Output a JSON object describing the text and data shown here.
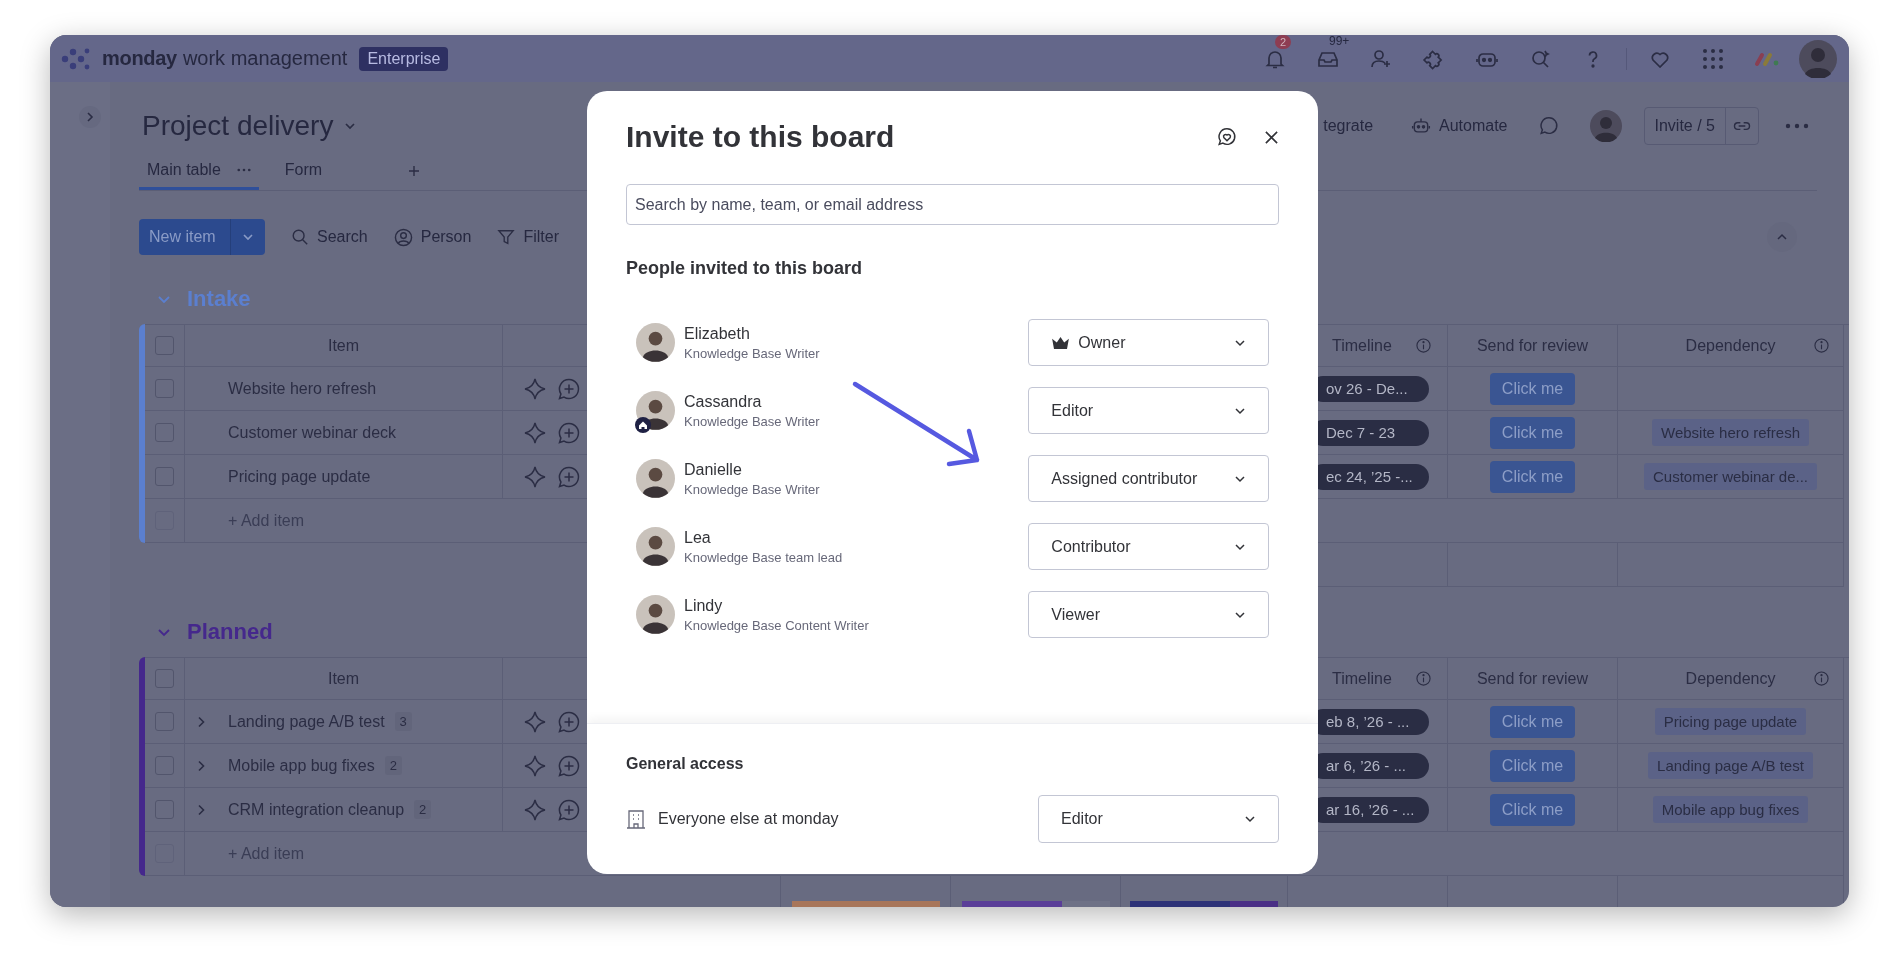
{
  "topbar": {
    "brand": "monday",
    "product": "work management",
    "plan": "Enterprise",
    "notification_count": "2",
    "inbox_count": "99+"
  },
  "board": {
    "title": "Project delivery",
    "integrate_label": "tegrate",
    "automate_label": "Automate",
    "invite_label": "Invite / 5"
  },
  "views": [
    {
      "label": "Main table",
      "selected": true
    },
    {
      "label": "Form",
      "selected": false
    }
  ],
  "toolbar": {
    "new_item": "New item",
    "search": "Search",
    "person": "Person",
    "filter": "Filter"
  },
  "groups": [
    {
      "title": "Intake",
      "color": "#5b7fcf",
      "status_summary": false,
      "select_all": false,
      "add_row_enabled": false,
      "columns": {
        "item": "Item",
        "timeline": "Timeline",
        "review": "Send for review",
        "dependency": "Dependency"
      },
      "add_item": "+ Add item",
      "rows": [
        {
          "name": "Website hero refresh",
          "checked": false,
          "timeline": "ov 26 - De...",
          "review": "Click me"
        },
        {
          "name": "Customer webinar deck",
          "checked": false,
          "timeline": "Dec 7 - 23",
          "review": "Click me",
          "dependency": "Website hero refresh"
        },
        {
          "name": "Pricing page update",
          "checked": false,
          "timeline": "ec 24, ’25 -...",
          "review": "Click me",
          "dependency": "Customer webinar de..."
        }
      ]
    },
    {
      "title": "Planned",
      "color": "#45288c",
      "status_summary": true,
      "select_all": false,
      "add_row_enabled": false,
      "columns": {
        "item": "Item",
        "timeline": "Timeline",
        "review": "Send for review",
        "dependency": "Dependency"
      },
      "add_item": "+ Add item",
      "rows": [
        {
          "name": "Landing page A/B test",
          "checked": false,
          "subitems": "3",
          "timeline": "eb 8, ’26 - ...",
          "review": "Click me",
          "dependency": "Pricing page update"
        },
        {
          "name": "Mobile app bug fixes",
          "checked": false,
          "subitems": "2",
          "timeline": "ar 6, ’26 - ...",
          "review": "Click me",
          "dependency": "Landing page A/B test"
        },
        {
          "name": "CRM integration cleanup",
          "checked": false,
          "subitems": "2",
          "timeline": "ar 16, ’26 - ...",
          "review": "Click me",
          "dependency": "Mobile app bug fixes"
        }
      ]
    }
  ],
  "modal": {
    "title": "Invite to this board",
    "search_placeholder": "Search by name, team, or email address",
    "people_heading": "People invited to this board",
    "people": [
      {
        "name": "Elizabeth",
        "role": "Knowledge Base Writer",
        "permission": "Owner",
        "owner": true,
        "home_badge": false
      },
      {
        "name": "Cassandra",
        "role": "Knowledge Base Writer",
        "permission": "Editor",
        "owner": false,
        "home_badge": true
      },
      {
        "name": "Danielle",
        "role": "Knowledge Base Writer",
        "permission": "Assigned contributor",
        "owner": false,
        "home_badge": false
      },
      {
        "name": "Lea",
        "role": "Knowledge Base team lead",
        "permission": "Contributor",
        "owner": false,
        "home_badge": false
      },
      {
        "name": "Lindy",
        "role": "Knowledge Base Content Writer",
        "permission": "Viewer",
        "owner": false,
        "home_badge": false
      }
    ],
    "general_heading": "General access",
    "general_label": "Everyone else at monday",
    "general_permission": "Editor"
  }
}
